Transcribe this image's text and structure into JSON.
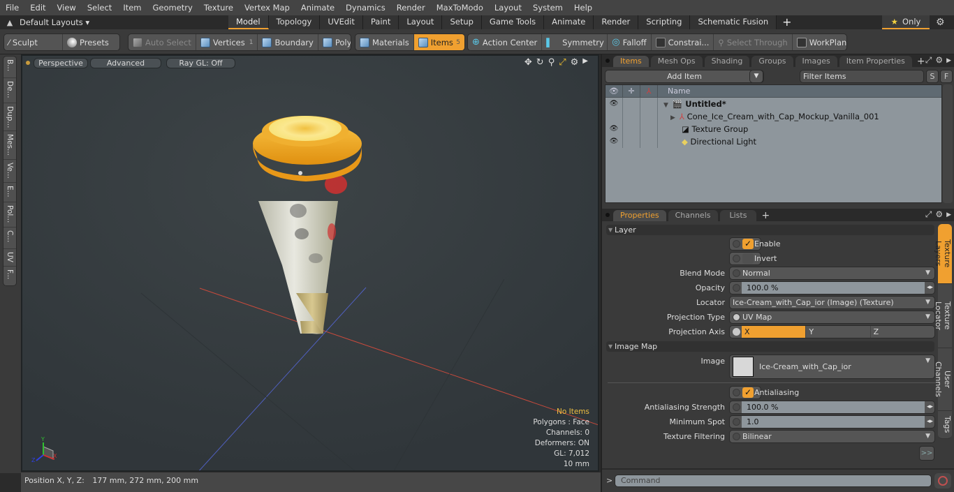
{
  "menu": [
    "File",
    "Edit",
    "View",
    "Select",
    "Item",
    "Geometry",
    "Texture",
    "Vertex Map",
    "Animate",
    "Dynamics",
    "Render",
    "MaxToModo",
    "Layout",
    "System",
    "Help"
  ],
  "layoutbar": {
    "layouts_label": "Default Layouts ▾",
    "tabs": [
      "Model",
      "Topology",
      "UVEdit",
      "Paint",
      "Layout",
      "Setup",
      "Game Tools",
      "Animate",
      "Render",
      "Scripting",
      "Schematic Fusion"
    ],
    "active_tab": "Model",
    "add_tab": "+",
    "only_label": "Only"
  },
  "toolbar": {
    "sculpt": "Sculpt",
    "presets": "Presets",
    "auto_select": "Auto Select",
    "vertices": "Vertices",
    "vertices_count": "1",
    "boundary": "Boundary",
    "polygons": "Polygons",
    "materials": "Materials",
    "items": "Items",
    "items_count": "5",
    "action_center": "Action Center",
    "symmetry": "Symmetry",
    "falloff": "Falloff",
    "constraints": "Constrai...",
    "select_through": "Select Through",
    "workplane": "WorkPlane"
  },
  "left_tabs": [
    "B...",
    "De...",
    "Dup...",
    "Mes...",
    "Ve...",
    "E...",
    "Pol...",
    "C...",
    "UV",
    "F..."
  ],
  "viewport": {
    "perspective": "Perspective",
    "advanced": "Advanced",
    "raygl": "Ray GL: Off",
    "info": {
      "no_items": "No Items",
      "polygons": "Polygons : Face",
      "channels": "Channels: 0",
      "deformers": "Deformers: ON",
      "gl": "GL: 7,012",
      "scale": "10 mm"
    },
    "axis_labels": {
      "y": "Y",
      "x": "X",
      "z": "Z"
    }
  },
  "status": {
    "position_label": "Position X, Y, Z:",
    "position_value": "177 mm, 272 mm, 200 mm"
  },
  "items_panel": {
    "tabs": [
      "Items",
      "Mesh Ops",
      "Shading",
      "Groups",
      "Images",
      "Item Properties"
    ],
    "active_tab": "Items",
    "add_item": "Add Item",
    "filter_placeholder": "Filter Items",
    "s_button": "S",
    "f_button": "F",
    "name_header": "Name",
    "rows": [
      {
        "name": "Untitled*",
        "visible": true,
        "bold": true
      },
      {
        "name": "Cone_Ice_Cream_with_Cap_Mockup_Vanilla_001",
        "visible": false,
        "bold": false
      },
      {
        "name": "Texture Group",
        "visible": true,
        "bold": false
      },
      {
        "name": "Directional Light",
        "visible": true,
        "bold": false
      }
    ]
  },
  "properties": {
    "tabs": [
      "Properties",
      "Channels",
      "Lists"
    ],
    "active_tab": "Properties",
    "layer_section": "Layer",
    "enable": {
      "label": "Enable",
      "checked": true
    },
    "invert": {
      "label": "Invert",
      "checked": false
    },
    "blend_mode": {
      "label": "Blend Mode",
      "value": "Normal"
    },
    "opacity": {
      "label": "Opacity",
      "value": "100.0 %"
    },
    "locator": {
      "label": "Locator",
      "value": "Ice-Cream_with_Cap_ior (Image) (Texture)"
    },
    "projection_type": {
      "label": "Projection Type",
      "value": "UV Map"
    },
    "projection_axis": {
      "label": "Projection Axis",
      "options": [
        "X",
        "Y",
        "Z"
      ],
      "selected": "X"
    },
    "image_map_section": "Image Map",
    "image": {
      "label": "Image",
      "value": "Ice-Cream_with_Cap_ior"
    },
    "antialiasing": {
      "label": "Antialiasing",
      "checked": true
    },
    "aa_strength": {
      "label": "Antialiasing Strength",
      "value": "100.0 %"
    },
    "min_spot": {
      "label": "Minimum Spot",
      "value": "1.0"
    },
    "tex_filter": {
      "label": "Texture Filtering",
      "value": "Bilinear"
    },
    "more": ">>",
    "side_tabs": [
      "Texture Layers",
      "Texture Locator",
      "User Channels",
      "Tags"
    ],
    "active_side_tab": "Texture Layers"
  },
  "command": {
    "prompt": ">",
    "placeholder": "Command"
  },
  "colors": {
    "accent": "#f0a030",
    "viewport_bg": "#353b3e",
    "info_yellow": "#f0c040"
  }
}
